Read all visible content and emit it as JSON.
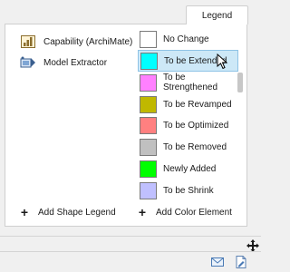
{
  "tab": {
    "label": "Legend"
  },
  "shapes": [
    {
      "label": "Capability (ArchiMate)",
      "icon": "capability-icon"
    },
    {
      "label": "Model Extractor",
      "icon": "model-extractor-icon"
    }
  ],
  "colors": [
    {
      "label": "No Change",
      "color": "#ffffff"
    },
    {
      "label": "To be Extended",
      "color": "#00ffff",
      "selected": true
    },
    {
      "label": "To be Strengthened",
      "color": "#ff80ff"
    },
    {
      "label": "To be Revamped",
      "color": "#c0b800"
    },
    {
      "label": "To be Optimized",
      "color": "#ff8080"
    },
    {
      "label": "To be Removed",
      "color": "#c0c0c0"
    },
    {
      "label": "Newly Added",
      "color": "#00ff00"
    },
    {
      "label": "To be Shrink",
      "color": "#c0c0ff"
    }
  ],
  "actions": {
    "add_shape_legend": "Add Shape Legend",
    "add_color_element": "Add Color Element"
  },
  "status_icons": [
    "mail-icon",
    "document-edit-icon"
  ]
}
